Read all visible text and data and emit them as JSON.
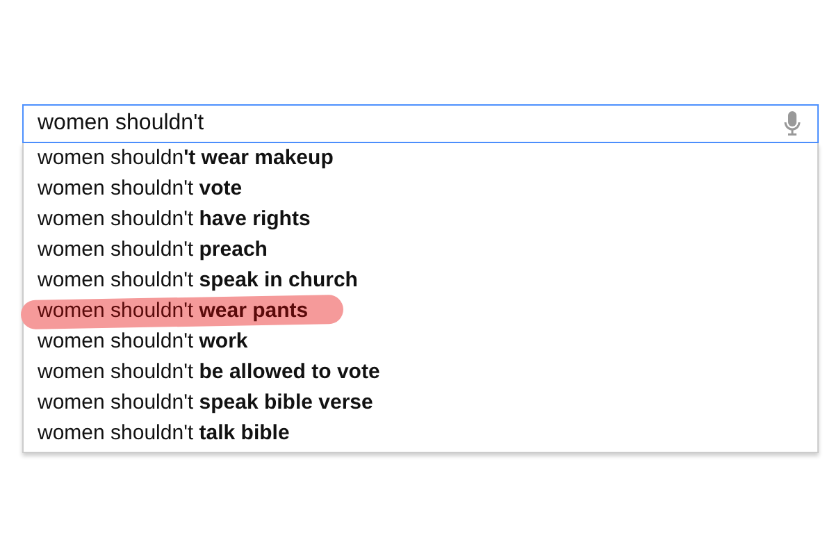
{
  "search": {
    "value": "women shouldn't"
  },
  "suggestions": [
    {
      "text": "women shouldn**'t wear makeup**",
      "highlighted": false
    },
    {
      "text": "women shouldn't **vote**",
      "highlighted": false
    },
    {
      "text": "women shouldn't **have rights**",
      "highlighted": false
    },
    {
      "text": "women shouldn't **preach**",
      "highlighted": false
    },
    {
      "text": "women shouldn't **speak in church**",
      "highlighted": false
    },
    {
      "text": "women shouldn't **wear pants**",
      "highlighted": true
    },
    {
      "text": "women shouldn't **work**",
      "highlighted": false
    },
    {
      "text": "women shouldn't **be allowed to vote**",
      "highlighted": false
    },
    {
      "text": "women shouldn't **speak bible verse**",
      "highlighted": false
    },
    {
      "text": "women shouldn't **talk bible**",
      "highlighted": false
    }
  ]
}
